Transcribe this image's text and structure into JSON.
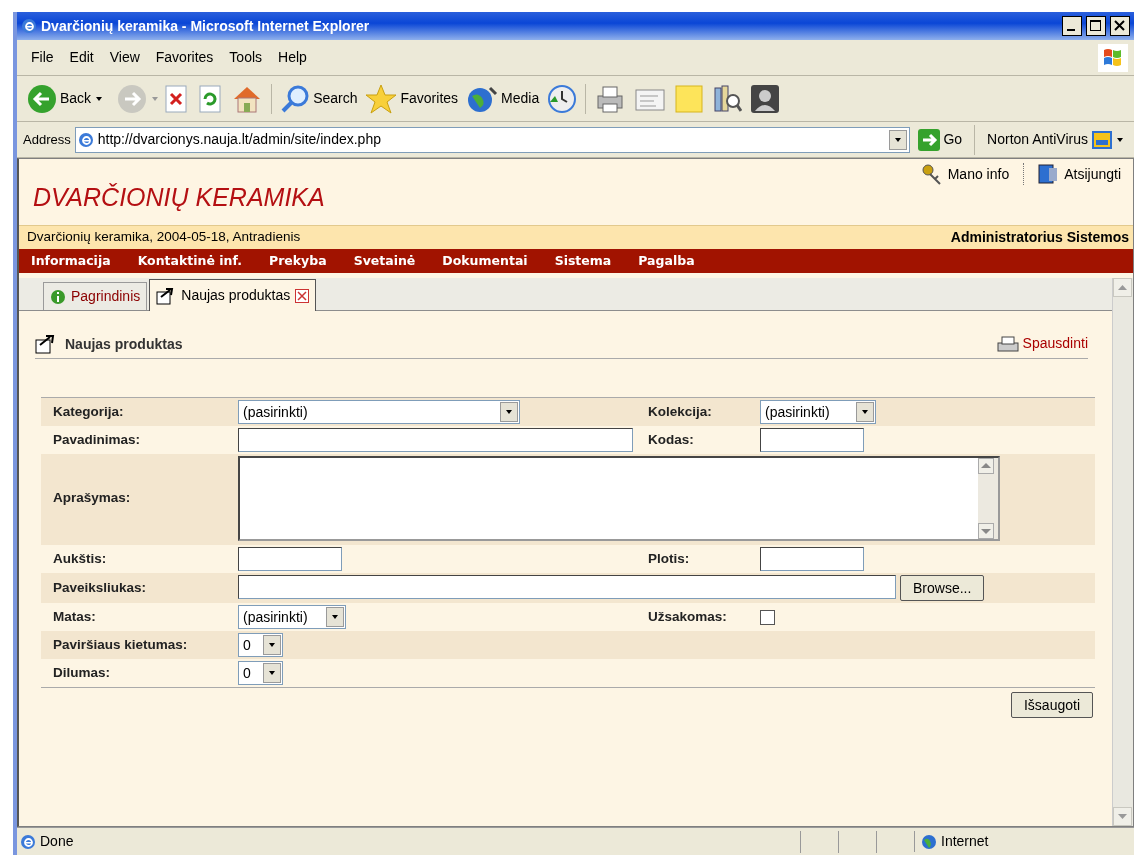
{
  "window": {
    "title": "Dvarčionių keramika - Microsoft Internet Explorer"
  },
  "menu": [
    "File",
    "Edit",
    "View",
    "Favorites",
    "Tools",
    "Help"
  ],
  "toolbar": {
    "back": "Back",
    "search": "Search",
    "favorites": "Favorites",
    "media": "Media"
  },
  "address": {
    "label": "Address",
    "url": "http://dvarcionys.nauja.lt/admin/site/index.php",
    "go": "Go",
    "norton": "Norton AntiVirus"
  },
  "site": {
    "logo": "DVARČIONIŲ KERAMIKA",
    "links": [
      "Mano info",
      "Atsijungti"
    ],
    "info_left": "Dvarčionių keramika,  2004-05-18, Antradienis",
    "info_right": "Administratorius Sistemos",
    "nav": [
      "Informacija",
      "Kontaktinė inf.",
      "Prekyba",
      "Svetainė",
      "Dokumentai",
      "Sistema",
      "Pagalba"
    ]
  },
  "tabs": [
    {
      "label": "Pagrindinis",
      "selected": false,
      "closable": false
    },
    {
      "label": "Naujas produktas",
      "selected": true,
      "closable": true
    }
  ],
  "page": {
    "heading": "Naujas produktas",
    "print": "Spausdinti"
  },
  "form": {
    "rows": [
      {
        "left": {
          "label": "Kategorija:",
          "kind": "select",
          "value": "(pasirinkti)"
        },
        "right": {
          "label": "Kolekcija:",
          "kind": "select",
          "value": "(pasirinkti)"
        }
      },
      {
        "left": {
          "label": "Pavadinimas:",
          "kind": "text"
        },
        "right": {
          "label": "Kodas:",
          "kind": "text"
        }
      },
      {
        "left": {
          "label": "Aprašymas:",
          "kind": "textarea"
        }
      },
      {
        "left": {
          "label": "Aukštis:",
          "kind": "text"
        },
        "right": {
          "label": "Plotis:",
          "kind": "text"
        }
      },
      {
        "left": {
          "label": "Paveiksliukas:",
          "kind": "file",
          "browse": "Browse..."
        }
      },
      {
        "left": {
          "label": "Matas:",
          "kind": "select",
          "value": "(pasirinkti)"
        },
        "right": {
          "label": "Užsakomas:",
          "kind": "checkbox",
          "checked": false
        }
      },
      {
        "left": {
          "label": "Paviršiaus kietumas:",
          "kind": "select",
          "value": "0"
        }
      },
      {
        "left": {
          "label": "Dilumas:",
          "kind": "select",
          "value": "0"
        }
      }
    ],
    "save": "Išsaugoti"
  },
  "status_bar": {
    "text": "Done",
    "zone": "Internet"
  }
}
